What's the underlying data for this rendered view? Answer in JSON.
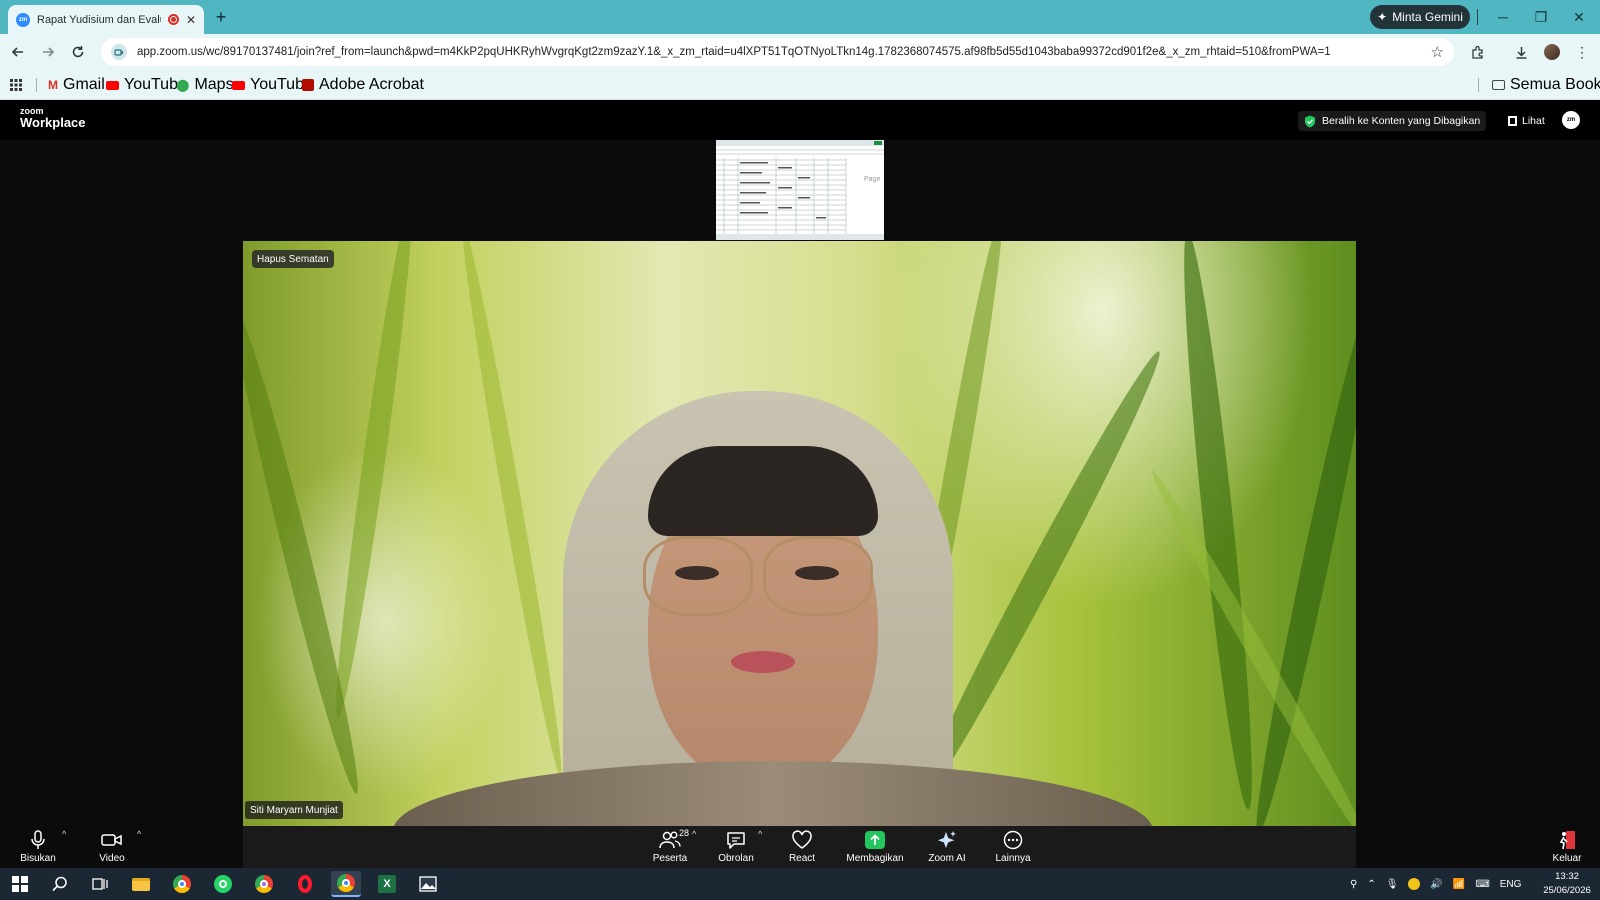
{
  "browser": {
    "tab_title": "Rapat Yudisium dan Evaluasi",
    "new_tab": "+",
    "gemini_label": "Minta Gemini",
    "url": "app.zoom.us/wc/89170137481/join?ref_from=launch&pwd=m4KkP2pqUHKRyhWvgrqKgt2zm9zazY.1&_x_zm_rtaid=u4lXPT51TqOTNyoLTkn14g.1782368074575.af98fb5d55d1043baba99372cd901f2e&_x_zm_rhtaid=510&fromPWA=1",
    "favicon_text": "zm",
    "bookmarks": [
      "Gmail",
      "YouTube",
      "Maps",
      "YouTube",
      "Adobe Acrobat"
    ],
    "all_bookmarks": "Semua Bookmark"
  },
  "zoom": {
    "logo_top": "zoom",
    "logo_bottom": "Workplace",
    "switch_content": "Beralih ke Konten yang Dibagikan",
    "view_label": "Lihat",
    "avatar_text": "zm",
    "thumb_text": "Page",
    "pin_label": "Hapus Sematan",
    "participant_name": "Siti Maryam Munjiat",
    "participant_count": "28",
    "controls": {
      "mute": "Bisukan",
      "video": "Video",
      "participants": "Peserta",
      "chat": "Obrolan",
      "react": "React",
      "share": "Membagikan",
      "zoom_ai": "Zoom AI",
      "more": "Lainnya",
      "leave": "Keluar"
    }
  },
  "taskbar": {
    "language": "ENG",
    "time": "13:32",
    "date": "25/06/2026"
  },
  "colors": {
    "tabbar": "#4fb6c2",
    "toolbar": "#e9f6f8",
    "share_green": "#22c55e",
    "leave_red": "#e0353b"
  }
}
